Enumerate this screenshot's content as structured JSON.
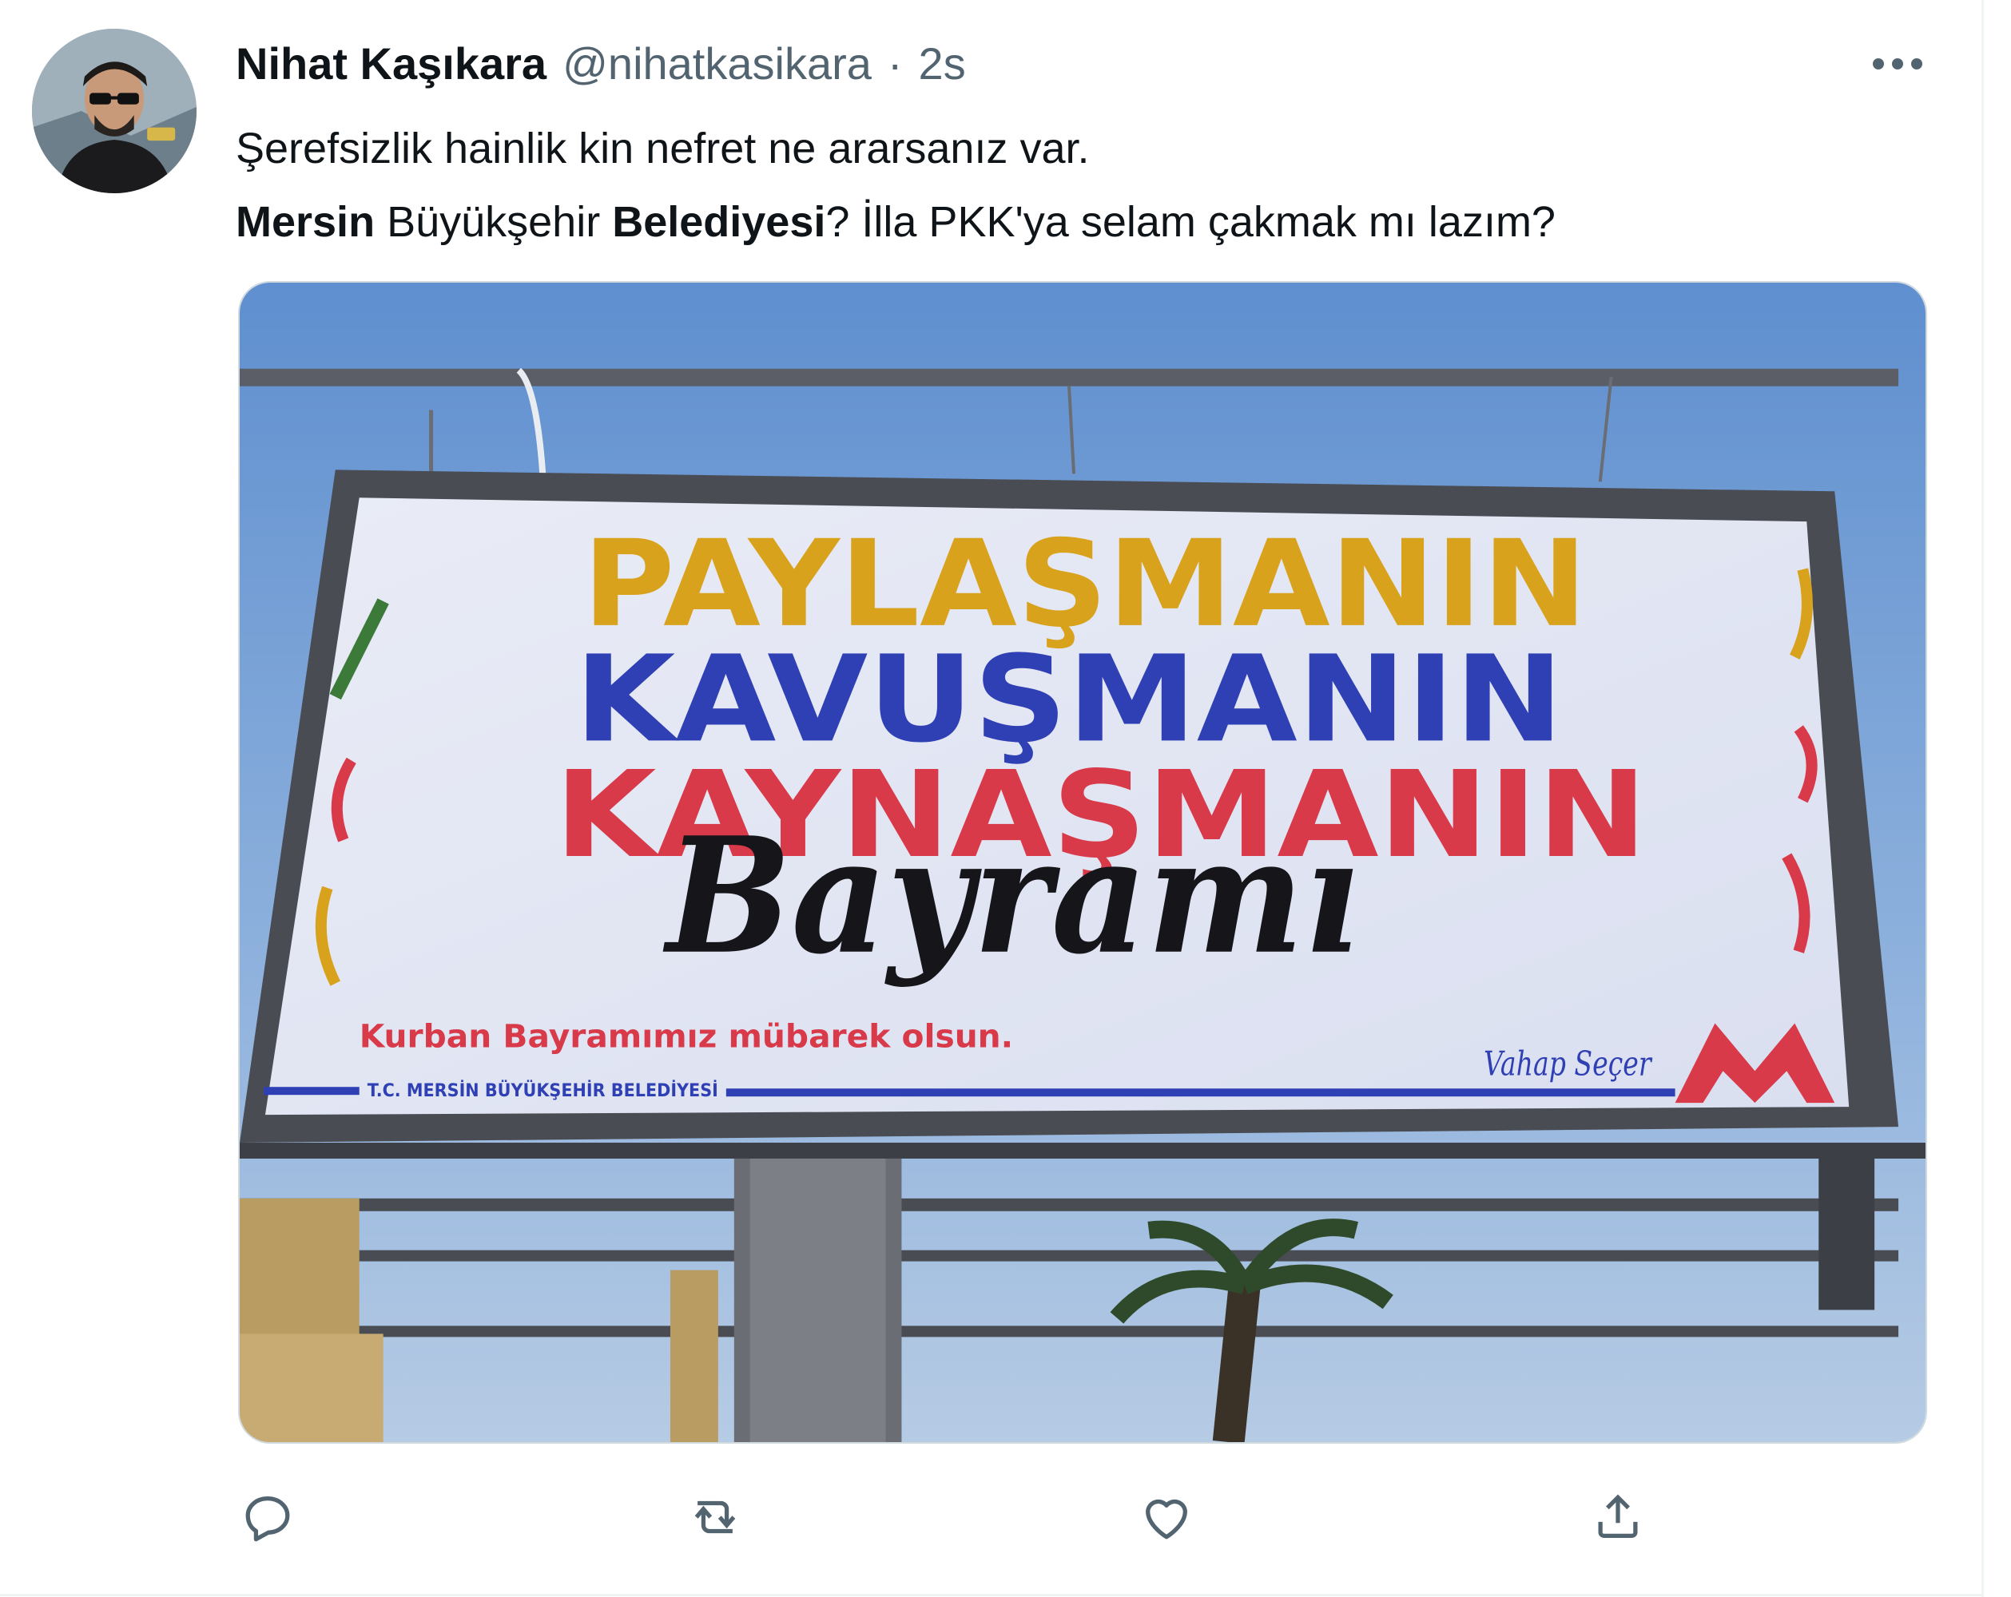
{
  "tweet": {
    "display_name": "Nihat Kaşıkara",
    "handle": "@nihatkasikara",
    "separator": "·",
    "timestamp": "2s",
    "text_line1": "Şerefsizlik hainlik kin nefret ne ararsanız var.",
    "text_line2": [
      {
        "text": "Mersin",
        "bold": true
      },
      {
        "text": " Büyükşehir ",
        "bold": false
      },
      {
        "text": "Belediyesi",
        "bold": true
      },
      {
        "text": "? İlla PKK'ya selam çakmak mı lazım?",
        "bold": false
      }
    ]
  },
  "billboard": {
    "line1": "PAYLAŞMANIN",
    "line2": "KAVUŞMANIN",
    "line3": "KAYNAŞMANIN",
    "script": "Bayramı",
    "greeting": "Kurban Bayramımız mübarek olsun.",
    "institution": "T.C. MERSİN BÜYÜKŞEHİR BELEDİYESİ",
    "signature": "Vahap Seçer"
  },
  "icons": {
    "more": "more-horizontal-icon",
    "reply": "reply-icon",
    "retweet": "retweet-icon",
    "like": "like-icon",
    "share": "share-icon"
  },
  "colors": {
    "text": "#0f1419",
    "secondary": "#536471",
    "billboard_yellow": "#d9a21d",
    "billboard_blue": "#2f3fb4",
    "billboard_red": "#d83a4a"
  }
}
